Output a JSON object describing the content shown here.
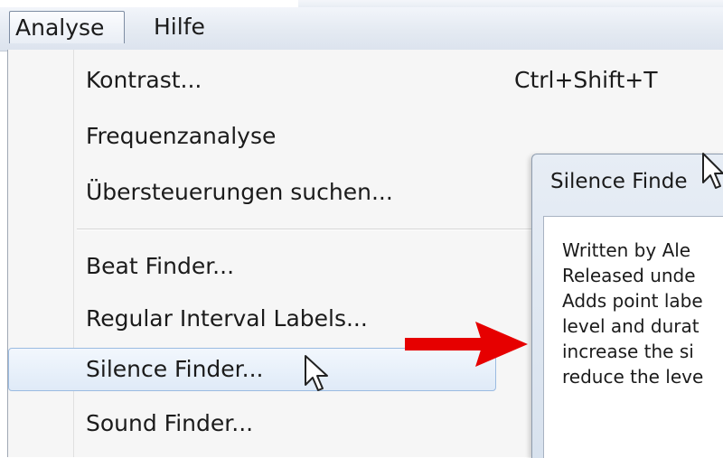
{
  "menubar": {
    "items": [
      {
        "label": "Analyse",
        "active": true
      },
      {
        "label": "Hilfe",
        "active": false
      }
    ]
  },
  "dropdown": {
    "items": [
      {
        "label": "Kontrast...",
        "shortcut": "Ctrl+Shift+T"
      },
      {
        "label": "Frequenzanalyse",
        "shortcut": ""
      },
      {
        "label": "Übersteuerungen suchen...",
        "shortcut": ""
      },
      {
        "label": "Beat Finder...",
        "shortcut": ""
      },
      {
        "label": "Regular Interval Labels...",
        "shortcut": ""
      },
      {
        "label": "Silence Finder...",
        "shortcut": "",
        "highlighted": true
      },
      {
        "label": "Sound Finder...",
        "shortcut": ""
      }
    ]
  },
  "dialog": {
    "title": "Silence Finde",
    "lines": [
      "Written by Ale",
      "Released unde",
      "Adds point labe",
      "level and durat",
      "increase the si",
      "reduce the leve"
    ]
  },
  "colors": {
    "highlight_border": "#9bbbe1",
    "arrow": "#e60000"
  },
  "icons": [
    "mouse-pointer-icon",
    "red-arrow-annotation"
  ]
}
